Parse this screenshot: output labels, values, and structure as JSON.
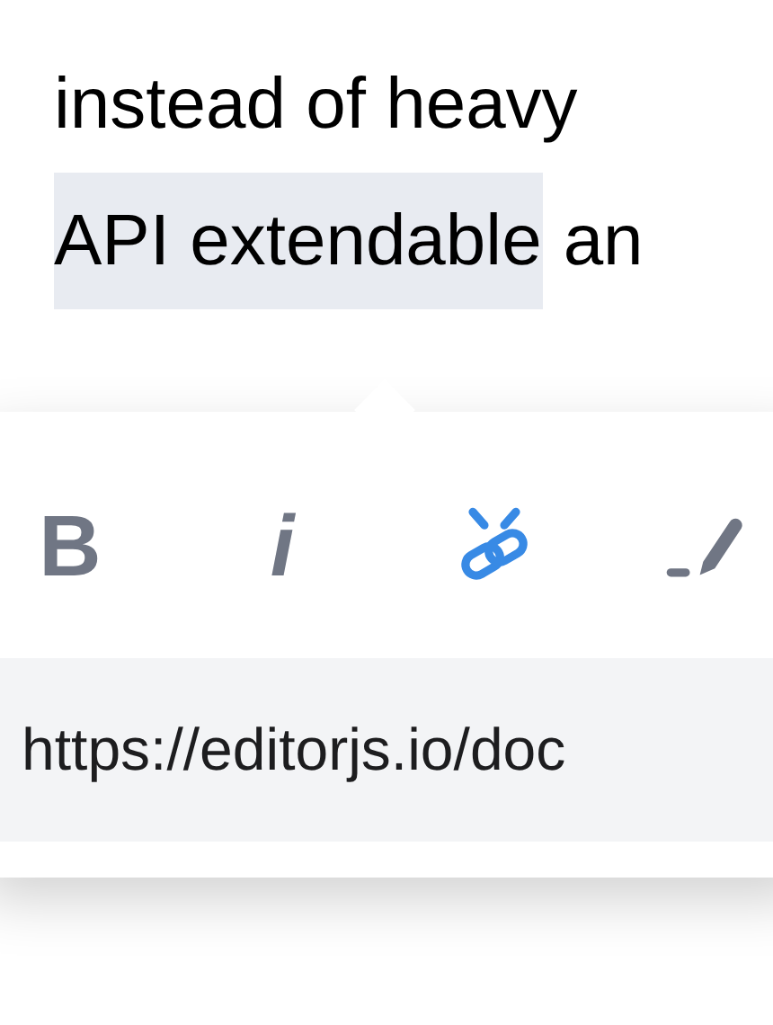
{
  "paragraph": {
    "line_1": "instead of heavy",
    "line_2_selected": "API extendable",
    "line_2_rest": "an"
  },
  "inline_toolbar": {
    "tools": [
      {
        "kind": "text",
        "label": "B",
        "selected": false
      },
      {
        "kind": "text_italic",
        "label": "i",
        "selected": false
      },
      {
        "kind": "link",
        "selected": true
      },
      {
        "kind": "marker",
        "selected": false
      }
    ],
    "link_input": {
      "value": "https://editorjs.io/doc"
    }
  }
}
